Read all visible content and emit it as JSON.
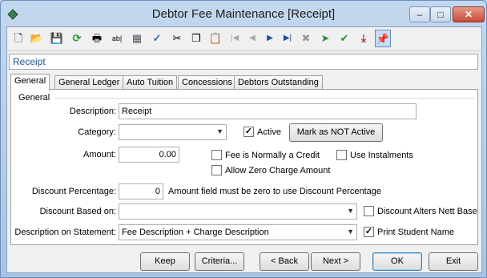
{
  "window": {
    "title": "Debtor Fee Maintenance  [Receipt]",
    "app_icon": "diamond-app-icon",
    "controls": {
      "minimize": "–",
      "maximize": "□",
      "close": "✕"
    }
  },
  "toolbar": {
    "icons": [
      "new-icon",
      "open-icon",
      "save-icon",
      "refresh-icon",
      "print-icon",
      "field-label-icon",
      "calculator-icon",
      "spellcheck-icon",
      "cut-icon",
      "copy-icon",
      "paste-icon",
      "first-record-icon",
      "previous-record-icon",
      "next-record-icon",
      "last-record-icon",
      "delete-icon",
      "filter-icon",
      "approve-icon",
      "download-icon",
      "pin-icon"
    ],
    "glyphs": [
      "🗋",
      "📂",
      "💾",
      "⟳",
      "🖶",
      "ab|",
      "▦",
      "✓",
      "✂",
      "❐",
      "📋",
      "|◀",
      "◀",
      "▶",
      "▶|",
      "✖",
      "➤",
      "✔",
      "⤓",
      "📌"
    ]
  },
  "record_bar": {
    "label": "Receipt"
  },
  "tabs": [
    {
      "label": "General",
      "active": true
    },
    {
      "label": "General Ledger",
      "active": false
    },
    {
      "label": "Auto Tuition",
      "active": false
    },
    {
      "label": "Concessions",
      "active": false
    },
    {
      "label": "Debtors Outstanding",
      "active": false
    }
  ],
  "general": {
    "group_label": "General",
    "description_label": "Description:",
    "description_value": "Receipt",
    "category_label": "Category:",
    "category_value": "",
    "active_label": "Active",
    "active_checked": true,
    "mark_not_active_label": "Mark as NOT Active",
    "amount_label": "Amount:",
    "amount_value": "0.00",
    "credit_label": "Fee is Normally a Credit",
    "credit_checked": false,
    "instalments_label": "Use Instalments",
    "instalments_checked": false,
    "zero_charge_label": "Allow Zero Charge Amount",
    "zero_charge_checked": false,
    "discount_pct_label": "Discount Percentage:",
    "discount_pct_value": "0",
    "discount_note": "Amount field must be zero to use Discount Percentage",
    "discount_based_label": "Discount Based on:",
    "discount_based_value": "",
    "discount_alters_label": "Discount Alters Nett Base",
    "discount_alters_checked": false,
    "statement_label": "Description on Statement:",
    "statement_value": "Fee Description + Charge Description",
    "print_student_label": "Print Student Name",
    "print_student_checked": true
  },
  "buttons": {
    "keep": "Keep",
    "criteria": "Criteria...",
    "back": "< Back",
    "next": "Next >",
    "ok": "OK",
    "exit": "Exit"
  }
}
